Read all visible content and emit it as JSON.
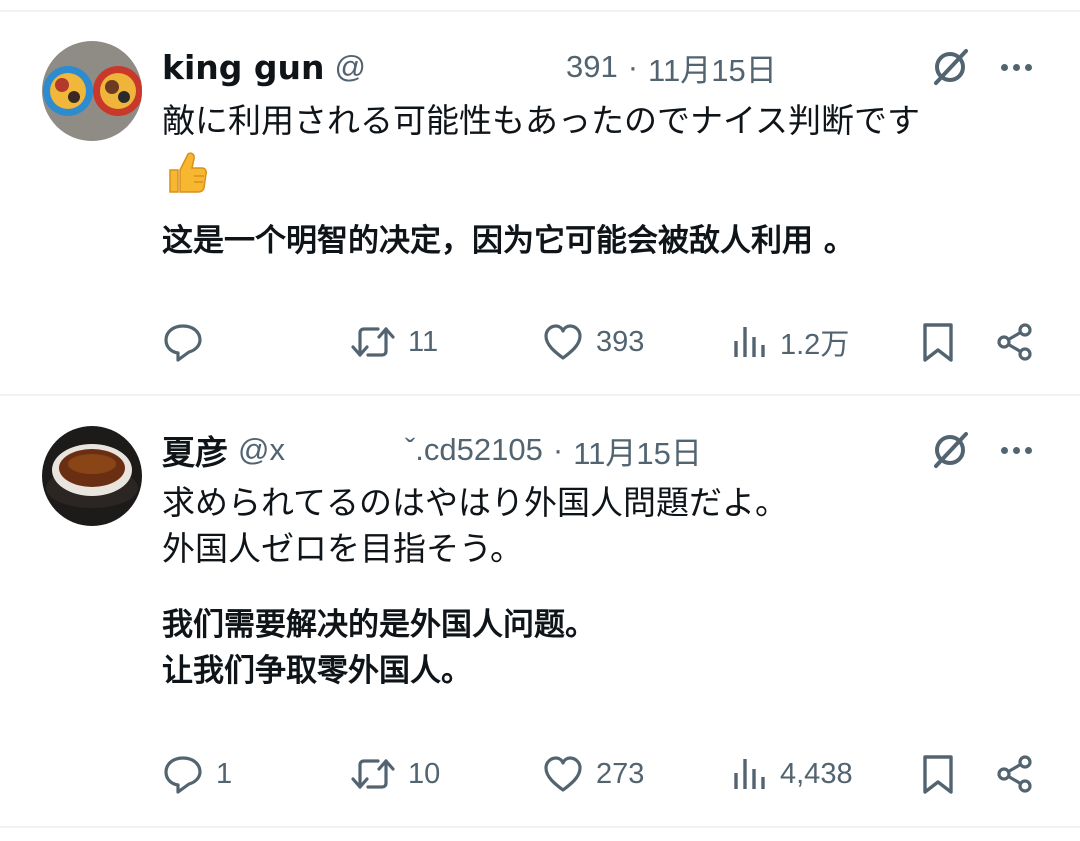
{
  "colors": {
    "text": "#0f1419",
    "secondary": "#536471",
    "divider": "#eff3f4",
    "thumb": "#f7b731"
  },
  "tweets": [
    {
      "author_name": "king gun",
      "handle_prefix": "@",
      "handle_suffix": "391",
      "separator": "·",
      "date": "11月15日",
      "text": "敵に利用される可能性もあったのでナイス判断です",
      "emoji": "thumbs-up",
      "translation": "这是一个明智的决定，因为它可能会被敌人利用 。",
      "reply_count": "",
      "retweet_count": "11",
      "like_count": "393",
      "view_count": "1.2万"
    },
    {
      "author_name": "夏彦",
      "handle_prefix": "@x",
      "handle_suffix": "ˇ.cd52105",
      "separator": "·",
      "date": "11月15日",
      "text": "求められてるのはやはり外国人問題だよ。\n外国人ゼロを目指そう。",
      "translation": "我们需要解决的是外国人问题。\n让我们争取零外国人。",
      "reply_count": "1",
      "retweet_count": "10",
      "like_count": "273",
      "view_count": "4,438"
    }
  ]
}
